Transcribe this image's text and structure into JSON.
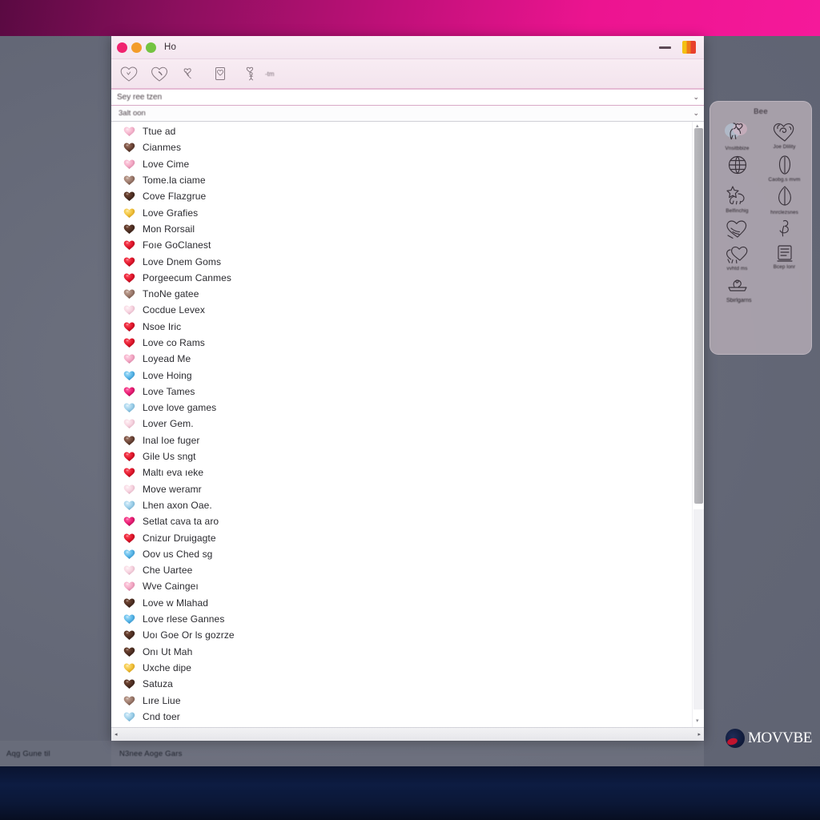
{
  "desktop": {
    "top_band_colors": [
      "#5a0a42",
      "#8c0f5e",
      "#c01079",
      "#ec1490",
      "#f5199a"
    ],
    "bottom_band_colors": [
      "#0a1430",
      "#0d1c42",
      "#070e21"
    ],
    "background_color": "#676b7a"
  },
  "window": {
    "title": "Ho",
    "traffic_lights": [
      {
        "name": "close",
        "color": "#f0226f"
      },
      {
        "name": "minimize",
        "color": "#f39c2a"
      },
      {
        "name": "maximize",
        "color": "#74c341"
      }
    ],
    "controls": {
      "minimize_label": "",
      "app_icon_colors": [
        "#f3c013",
        "#ef7a1b",
        "#e8402c"
      ]
    },
    "toolbar": {
      "icons": [
        {
          "name": "heart-outline-icon"
        },
        {
          "name": "heart-check-icon"
        },
        {
          "name": "double-heart-icon"
        },
        {
          "name": "heart-page-icon"
        },
        {
          "name": "heart-person-icon"
        }
      ],
      "note": "-tm"
    },
    "search": {
      "value": "Sey ree tzen",
      "placeholder": "Sey ree tzen",
      "chevron": "⌄"
    },
    "filter": {
      "value": "3alt oon",
      "chevron": "⌄"
    },
    "scrollbar": {
      "vertical_thumb_percent": 62,
      "top_cap": "▴",
      "bottom_cap": "▾",
      "h_left_arrow": "◂",
      "h_right_arrow": "▸"
    }
  },
  "list": {
    "items": [
      {
        "label": "Ttue ad",
        "heart": "pink-light"
      },
      {
        "label": "Cianmes",
        "heart": "brown-mottle"
      },
      {
        "label": "Love Cime",
        "heart": "pink"
      },
      {
        "label": "Tome.la ciame",
        "heart": "brown-light"
      },
      {
        "label": "Cove Flazgrue",
        "heart": "brown-dark"
      },
      {
        "label": "Love Grafies",
        "heart": "gold"
      },
      {
        "label": "Mon Rorsail",
        "heart": "brown-dark"
      },
      {
        "label": "Foıe GoClanest",
        "heart": "red"
      },
      {
        "label": "Love Dnem Goms",
        "heart": "red"
      },
      {
        "label": "Porgeecum Canmes",
        "heart": "red"
      },
      {
        "label": "TnoNe gatee",
        "heart": "brown-light"
      },
      {
        "label": "Cocdue Levex",
        "heart": "pink-pale"
      },
      {
        "label": "Nsoe Iric",
        "heart": "red"
      },
      {
        "label": "Love co Rams",
        "heart": "red"
      },
      {
        "label": "Loyead Me",
        "heart": "pink"
      },
      {
        "label": "Love Hoing",
        "heart": "blue"
      },
      {
        "label": "Love Tames",
        "heart": "magenta"
      },
      {
        "label": "Love love games",
        "heart": "blue-pale"
      },
      {
        "label": "Lover Gem.",
        "heart": "pink-pale"
      },
      {
        "label": "Inal Ioe fuger",
        "heart": "brown-mottle"
      },
      {
        "label": "Gile Us sngt",
        "heart": "red"
      },
      {
        "label": "Maltı eva ıeke",
        "heart": "red"
      },
      {
        "label": "Move weramr",
        "heart": "pink-pale"
      },
      {
        "label": "Lhen axon Oae.",
        "heart": "blue-pale"
      },
      {
        "label": "Setlat cava ta aro",
        "heart": "magenta"
      },
      {
        "label": "Cnizur Druigagte",
        "heart": "red"
      },
      {
        "label": "Oov us Ched sg",
        "heart": "blue"
      },
      {
        "label": "Che Uartee",
        "heart": "pink-pale"
      },
      {
        "label": "Wve Caingeı",
        "heart": "pink"
      },
      {
        "label": "Love w Mlahad",
        "heart": "brown-dark"
      },
      {
        "label": "Love rlese Gannes",
        "heart": "blue"
      },
      {
        "label": "Uoı Goe Or ls gozrze",
        "heart": "brown-dark"
      },
      {
        "label": "Onı Ut Mah",
        "heart": "brown-dark"
      },
      {
        "label": "Uxche dipe",
        "heart": "gold"
      },
      {
        "label": "Satuza",
        "heart": "brown-dark"
      },
      {
        "label": "Lıre Liue",
        "heart": "brown-light"
      },
      {
        "label": "Cnd toer",
        "heart": "blue-pale"
      }
    ]
  },
  "panel": {
    "title": "Bee",
    "items": [
      {
        "label": "Vnsitbbize",
        "icon": "sketch-couple-icon"
      },
      {
        "label": "Joe Dlility",
        "icon": "sketch-heart-snail-icon"
      },
      {
        "label": "",
        "icon": "sketch-globe-icon"
      },
      {
        "label": "Caobg.s mvm",
        "icon": "sketch-label-icon"
      },
      {
        "label": "Belfinchig",
        "icon": "sketch-star-dog-icon"
      },
      {
        "label": "hnrclezsnes",
        "icon": "sketch-leaf-icon"
      },
      {
        "label": "",
        "icon": "sketch-heart-swirl-icon"
      },
      {
        "label": "",
        "icon": "sketch-hand-icon"
      },
      {
        "label": "vvhtd ms",
        "icon": "sketch-heart-figure-icon"
      },
      {
        "label": "Bcep lonr",
        "icon": "sketch-frame-icon"
      },
      {
        "label": "",
        "icon": "sketch-tablet-icon"
      }
    ],
    "footer": "Sbirlgarns"
  },
  "statusbar": {
    "left_text": "Aqg Gune til",
    "mid_text": "N3nee Aoge Gars"
  },
  "watermark": {
    "text": "MOVVBE",
    "mark": "globe-logo-icon"
  }
}
